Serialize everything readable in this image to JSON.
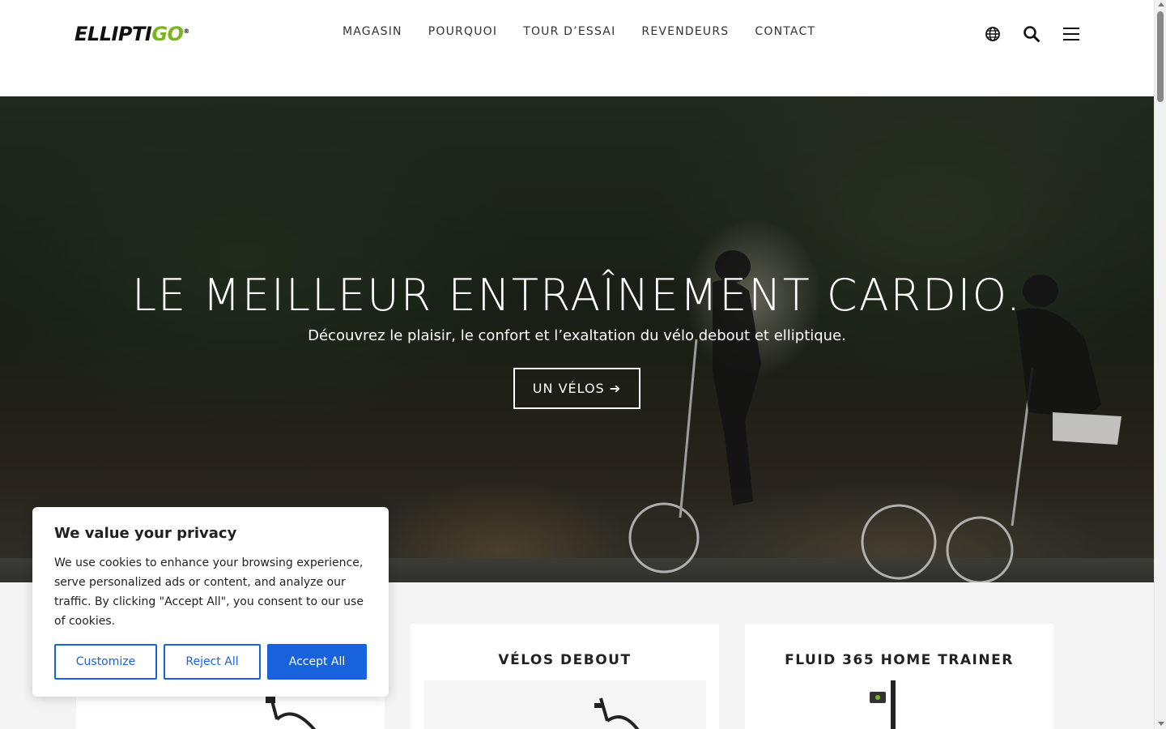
{
  "header": {
    "logo": {
      "main": "ELLIPTI",
      "accent": "GO",
      "reg": "®"
    },
    "nav": [
      "MAGASIN",
      "POURQUOI",
      "TOUR D’ESSAI",
      "REVENDEURS",
      "CONTACT"
    ],
    "icons": [
      "globe-icon",
      "search-icon",
      "menu-icon"
    ]
  },
  "hero": {
    "title": "LE MEILLEUR ENTRAÎNEMENT CARDIO.",
    "subtitle": "Découvrez le plaisir, le confort et l’exaltation du vélo debout et elliptique.",
    "button": "UN VÉLOS ➔"
  },
  "cards": [
    {
      "title": ""
    },
    {
      "title": "VÉLOS DEBOUT"
    },
    {
      "title": "FLUID 365 HOME TRAINER"
    }
  ],
  "cookie": {
    "title": "We value your privacy",
    "body": "We use cookies to enhance your browsing experience, serve personalized ads or content, and analyze our traffic. By clicking \"Accept All\", you consent to our use of cookies.",
    "customize": "Customize",
    "reject": "Reject All",
    "accept": "Accept All"
  },
  "colors": {
    "brand_green": "#7ab51d",
    "cookie_blue": "#1863dc"
  }
}
